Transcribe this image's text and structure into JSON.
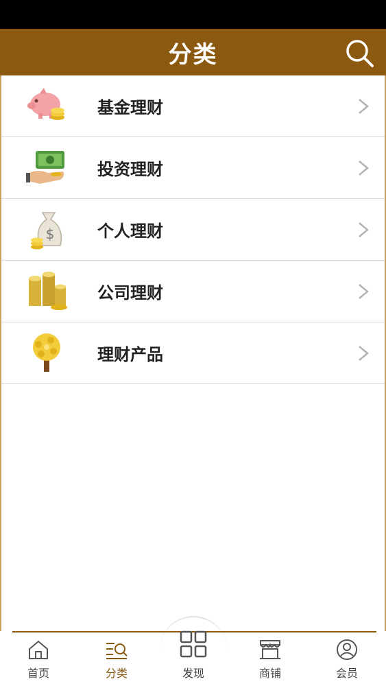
{
  "header": {
    "title": "分类"
  },
  "categories": [
    {
      "label": "基金理财",
      "icon": "piggy-bank-icon"
    },
    {
      "label": "投资理财",
      "icon": "money-hand-icon"
    },
    {
      "label": "个人理财",
      "icon": "money-bag-icon"
    },
    {
      "label": "公司理财",
      "icon": "coin-stacks-icon"
    },
    {
      "label": "理财产品",
      "icon": "money-tree-icon"
    }
  ],
  "tabbar": {
    "tabs": [
      {
        "label": "首页",
        "icon": "home-icon"
      },
      {
        "label": "分类",
        "icon": "category-icon",
        "active": true
      },
      {
        "label": "发现",
        "icon": "grid-icon"
      },
      {
        "label": "商铺",
        "icon": "shop-icon"
      },
      {
        "label": "会员",
        "icon": "user-icon"
      }
    ]
  },
  "colors": {
    "primary": "#8b5a10",
    "status_bar": "#000000",
    "divider": "#d9d9d9"
  }
}
